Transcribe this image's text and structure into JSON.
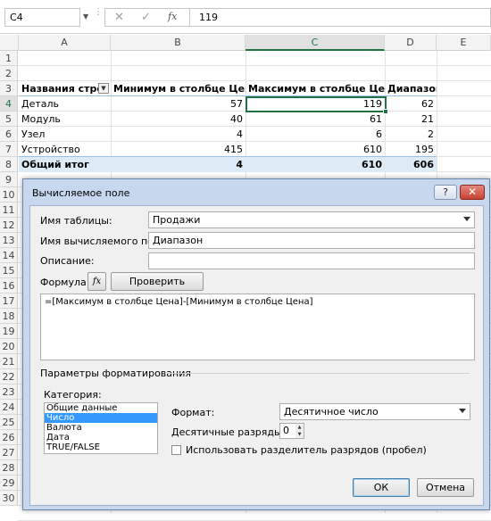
{
  "formula_bar": {
    "name_box": "C4",
    "cancel_icon": "✕",
    "enter_icon": "✓",
    "fx_label": "fx",
    "value": "119"
  },
  "columns": [
    "A",
    "B",
    "C",
    "D",
    "E"
  ],
  "rows": [
    "1",
    "2",
    "3",
    "4",
    "5",
    "6",
    "7",
    "8",
    "9",
    "10",
    "11",
    "12",
    "13",
    "14",
    "15",
    "16",
    "17",
    "18",
    "19",
    "20",
    "21",
    "22",
    "23",
    "24",
    "25",
    "26",
    "27",
    "28",
    "29",
    "30"
  ],
  "pivot": {
    "headers": [
      "Названия строк",
      "Минимум в столбце Цена",
      "Максимум в столбце Цена",
      "Диапазон"
    ],
    "data": [
      [
        "Деталь",
        "57",
        "119",
        "62"
      ],
      [
        "Модуль",
        "40",
        "61",
        "21"
      ],
      [
        "Узел",
        "4",
        "6",
        "2"
      ],
      [
        "Устройство",
        "415",
        "610",
        "195"
      ]
    ],
    "total": [
      "Общий итог",
      "4",
      "610",
      "606"
    ]
  },
  "dialog": {
    "title": "Вычисляемое поле",
    "help_label": "?",
    "close_label": "✕",
    "table_name_label": "Имя таблицы:",
    "table_name_value": "Продажи",
    "field_name_label": "Имя вычисляемого поля:",
    "field_name_value": "Диапазон",
    "description_label": "Описание:",
    "description_value": "",
    "formula_label": "Формула:",
    "fx_button": "fx",
    "check_formula_button": "Проверить формулу",
    "formula_value": "=[Максимум в столбце Цена]-[Минимум в столбце Цена]",
    "formatting_section": "Параметры форматирования",
    "category_label": "Категория:",
    "categories": [
      "Общие данные",
      "Число",
      "Валюта",
      "Дата",
      "TRUE/FALSE"
    ],
    "selected_category": "Число",
    "format_label": "Формат:",
    "format_value": "Десятичное число",
    "decimals_label": "Десятичные разряды:",
    "decimals_value": "0",
    "separator_label": "Использовать разделитель разрядов (пробел)",
    "separator_checked": false,
    "ok_button": "ОК",
    "cancel_button": "Отмена"
  },
  "colors": {
    "accent": "#217346",
    "pivot_band": "#ddebf7",
    "dialog_frame": "#c7d8ee",
    "selection": "#3399ff"
  }
}
